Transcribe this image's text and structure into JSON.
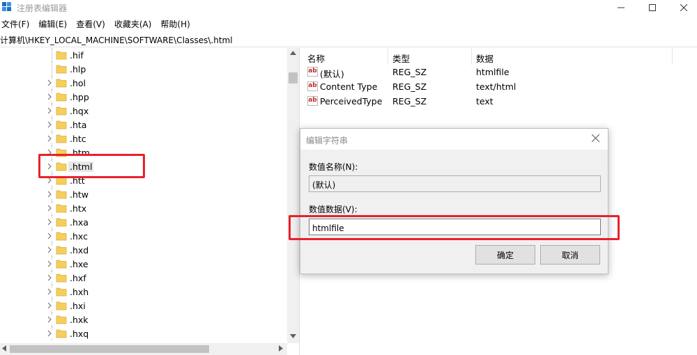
{
  "app": {
    "title": "注册表编辑器",
    "icon": "registry-editor-icon",
    "window_controls": {
      "minimize": "minimize-icon",
      "maximize": "maximize-icon",
      "close": "close-icon"
    }
  },
  "menu": [
    {
      "label": "文件(F)"
    },
    {
      "label": "编辑(E)"
    },
    {
      "label": "查看(V)"
    },
    {
      "label": "收藏夹(A)"
    },
    {
      "label": "帮助(H)"
    }
  ],
  "address": {
    "path": "计算机\\HKEY_LOCAL_MACHINE\\SOFTWARE\\Classes\\.html"
  },
  "tree": {
    "items": [
      {
        "label": ".hif",
        "expandable": false,
        "selected": false
      },
      {
        "label": ".hlp",
        "expandable": false,
        "selected": false
      },
      {
        "label": ".hol",
        "expandable": true,
        "selected": false
      },
      {
        "label": ".hpp",
        "expandable": true,
        "selected": false
      },
      {
        "label": ".hqx",
        "expandable": true,
        "selected": false
      },
      {
        "label": ".hta",
        "expandable": true,
        "selected": false
      },
      {
        "label": ".htc",
        "expandable": true,
        "selected": false
      },
      {
        "label": ".htm",
        "expandable": true,
        "selected": false
      },
      {
        "label": ".html",
        "expandable": true,
        "selected": true
      },
      {
        "label": ".htt",
        "expandable": true,
        "selected": false
      },
      {
        "label": ".htw",
        "expandable": true,
        "selected": false
      },
      {
        "label": ".htx",
        "expandable": true,
        "selected": false
      },
      {
        "label": ".hxa",
        "expandable": true,
        "selected": false
      },
      {
        "label": ".hxc",
        "expandable": true,
        "selected": false
      },
      {
        "label": ".hxd",
        "expandable": true,
        "selected": false
      },
      {
        "label": ".hxe",
        "expandable": true,
        "selected": false
      },
      {
        "label": ".hxf",
        "expandable": true,
        "selected": false
      },
      {
        "label": ".hxh",
        "expandable": true,
        "selected": false
      },
      {
        "label": ".hxi",
        "expandable": true,
        "selected": false
      },
      {
        "label": ".hxk",
        "expandable": true,
        "selected": false
      },
      {
        "label": ".hxq",
        "expandable": true,
        "selected": false
      }
    ]
  },
  "values": {
    "headers": {
      "name": "名称",
      "type": "类型",
      "data": "数据"
    },
    "rows": [
      {
        "name": "(默认)",
        "type": "REG_SZ",
        "data": "htmlfile",
        "icon": "string-value-icon"
      },
      {
        "name": "Content Type",
        "type": "REG_SZ",
        "data": "text/html",
        "icon": "string-value-icon"
      },
      {
        "name": "PerceivedType",
        "type": "REG_SZ",
        "data": "text",
        "icon": "string-value-icon"
      }
    ]
  },
  "dialog": {
    "title": "编辑字符串",
    "name_label": "数值名称(N):",
    "name_value": "(默认)",
    "data_label": "数值数据(V):",
    "data_value": "htmlfile",
    "ok_label": "确定",
    "cancel_label": "取消"
  },
  "colors": {
    "highlight": "#e8212a",
    "folder": "#f5cf5d",
    "selection": "#e8e8e8"
  }
}
